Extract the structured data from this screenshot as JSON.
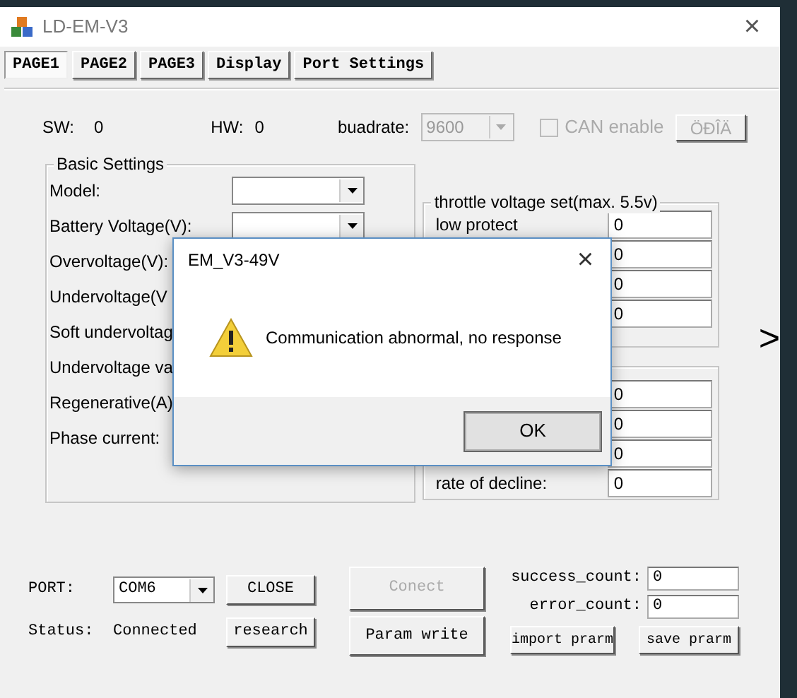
{
  "window": {
    "title": "LD-EM-V3",
    "close": "×"
  },
  "tabs": [
    {
      "label": "PAGE1",
      "selected": true
    },
    {
      "label": "PAGE2",
      "selected": false
    },
    {
      "label": "PAGE3",
      "selected": false
    },
    {
      "label": "Display",
      "selected": false
    },
    {
      "label": "Port Settings",
      "selected": false
    }
  ],
  "info": {
    "sw_label": "SW:",
    "sw": "0",
    "hw_label": "HW:",
    "hw": "0",
    "baud_label": "buadrate:",
    "baud": "9600",
    "baud_disabled": true,
    "can_label": "CAN enable",
    "can_checked": false,
    "can_disabled": true,
    "lang_button": "ÖÐÎÄ",
    "lang_disabled": true
  },
  "basic_settings": {
    "title": "Basic Settings",
    "rows": [
      {
        "label": "Model:",
        "kind": "combo"
      },
      {
        "label": "Battery Voltage(V):",
        "kind": "combo"
      },
      {
        "label": "Overvoltage(V):",
        "kind": "label"
      },
      {
        "label": "Undervoltage(V",
        "kind": "label"
      },
      {
        "label": "Soft undervoltag",
        "kind": "label"
      },
      {
        "label": "Undervoltage va",
        "kind": "label"
      },
      {
        "label": "Regenerative(A)",
        "kind": "label"
      },
      {
        "label": "Phase current:",
        "kind": "label"
      }
    ]
  },
  "throttle": {
    "title": "throttle voltage set(max. 5.5v)",
    "rows": [
      {
        "label": "low protect",
        "value": "0"
      },
      {
        "value": "0"
      },
      {
        "value": "0"
      },
      {
        "value": "0"
      }
    ]
  },
  "group_2": {
    "rows": [
      {
        "value": "0"
      },
      {
        "value": "0"
      },
      {
        "value": "0"
      },
      {
        "label": "rate of decline:",
        "value": "0"
      }
    ]
  },
  "next_arrow": ">",
  "port": {
    "port_label": "PORT:",
    "port": "COM6",
    "close_button": "CLOSE",
    "status_label": "Status:",
    "status": "Connected",
    "research_button": "research",
    "connect_button": "Conect",
    "connect_disabled": true,
    "param_write_button": "Param write",
    "success_label": "success_count:",
    "success": "0",
    "error_label": "error_count:",
    "error": "0",
    "import_button": "import prarm",
    "save_button": "save prarm"
  },
  "dialog": {
    "title": "EM_V3-49V",
    "close": "×",
    "message": "Communication abnormal, no response",
    "ok_button": "OK"
  }
}
